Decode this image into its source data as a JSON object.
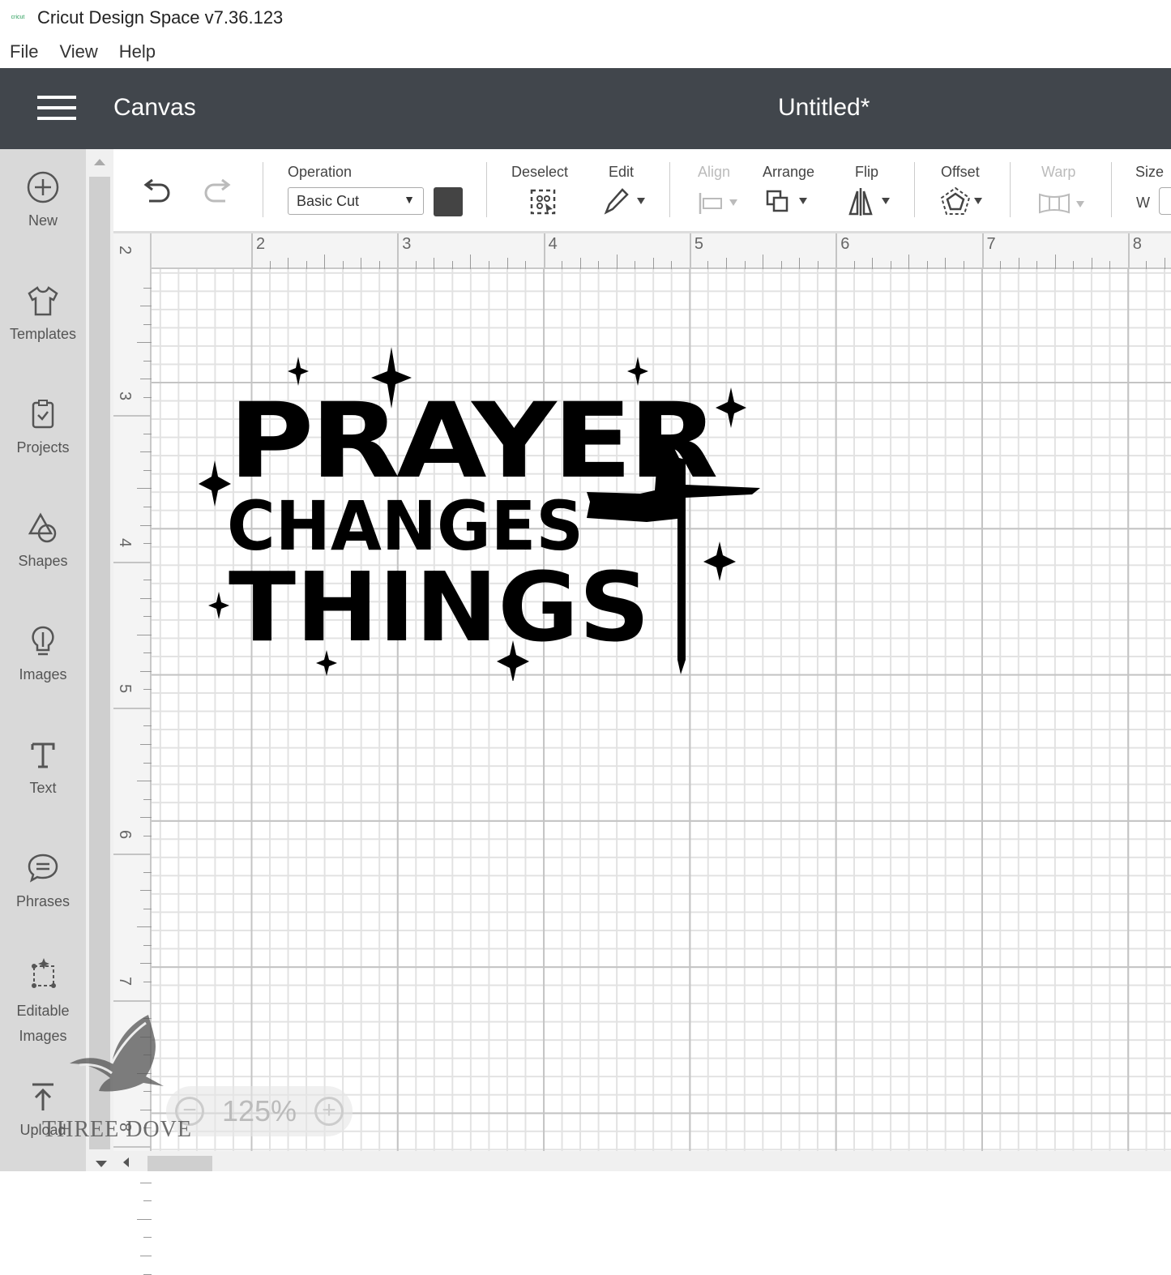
{
  "window": {
    "app_title": "Cricut Design Space  v7.36.123",
    "logo_text": "cricut"
  },
  "menu": [
    "File",
    "View",
    "Help"
  ],
  "header": {
    "section": "Canvas",
    "document_title": "Untitled*"
  },
  "sidebar": {
    "items": [
      {
        "label": "New",
        "icon": "plus-circle-icon"
      },
      {
        "label": "Templates",
        "icon": "tshirt-icon"
      },
      {
        "label": "Projects",
        "icon": "clipboard-icon"
      },
      {
        "label": "Shapes",
        "icon": "shapes-icon"
      },
      {
        "label": "Images",
        "icon": "lightbulb-icon"
      },
      {
        "label": "Text",
        "icon": "text-icon"
      },
      {
        "label": "Phrases",
        "icon": "speech-bubble-icon"
      },
      {
        "label": "Editable Images",
        "icon": "editable-image-icon"
      },
      {
        "label": "Upload",
        "icon": "upload-icon"
      }
    ]
  },
  "toolbar": {
    "operation_label": "Operation",
    "operation_value": "Basic Cut",
    "operation_color": "#444444",
    "deselect": "Deselect",
    "edit": "Edit",
    "align": "Align",
    "arrange": "Arrange",
    "flip": "Flip",
    "offset": "Offset",
    "warp": "Warp",
    "size": "Size",
    "size_w": "W"
  },
  "rulers": {
    "horizontal": [
      "2",
      "3",
      "4",
      "5",
      "6",
      "7",
      "8"
    ],
    "vertical": [
      "2",
      "3",
      "4",
      "5",
      "6",
      "7",
      "8"
    ]
  },
  "design": {
    "lines": [
      "PRAYER",
      "CHANGES",
      "THINGS"
    ]
  },
  "zoom": {
    "level": "125%",
    "minus": "−",
    "plus": "+"
  },
  "watermark": {
    "text": "THREE DOVE"
  }
}
